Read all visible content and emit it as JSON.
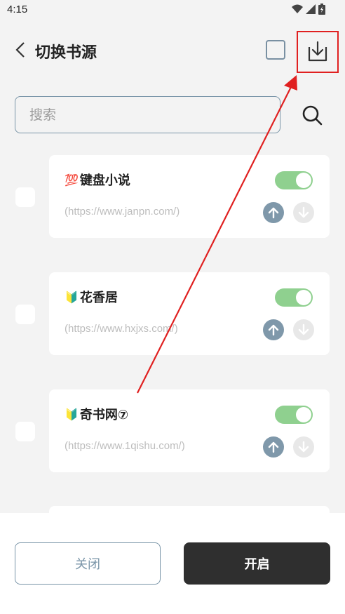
{
  "status_bar": {
    "time": "4:15",
    "icons": [
      "wifi-icon",
      "signal-icon",
      "battery-icon"
    ]
  },
  "header": {
    "title": "切换书源",
    "back_icon": "chevron-left-icon",
    "export_icon": "download-tray-icon"
  },
  "search": {
    "placeholder": "搜索",
    "value": ""
  },
  "sources": [
    {
      "emoji": "💯",
      "name": "键盘小说",
      "url": "(https://www.janpn.com/)",
      "enabled": true
    },
    {
      "emoji": "🔰",
      "name": "花香居",
      "url": "(https://www.hxjxs.com/)",
      "enabled": true
    },
    {
      "emoji": "🔰",
      "name": "奇书网⑦",
      "url": "(https://www.1qishu.com/)",
      "enabled": true
    }
  ],
  "footer": {
    "close_label": "关闭",
    "open_label": "开启"
  },
  "colors": {
    "accent": "#7a95a8",
    "toggle_on": "#8fd08f",
    "primary_button": "#2f2f2f",
    "highlight": "#e02020"
  }
}
